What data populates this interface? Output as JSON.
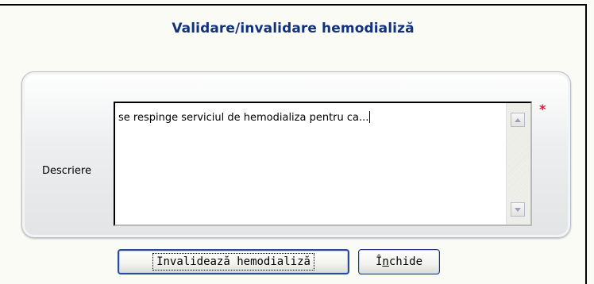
{
  "dialog": {
    "title": "Validare/invalidare hemodializă"
  },
  "form": {
    "description_label": "Descriere",
    "description_value": "se respinge serviciul de hemodializa pentru ca...",
    "required_marker": "*"
  },
  "buttons": {
    "invalidate_label": "Invalidează hemodializă",
    "close_label_prefix": "Î",
    "close_label_accesskey": "n",
    "close_label_suffix": "chide"
  },
  "colors": {
    "title": "#12327a",
    "required": "#e0172e",
    "background": "#fbfbf6"
  }
}
